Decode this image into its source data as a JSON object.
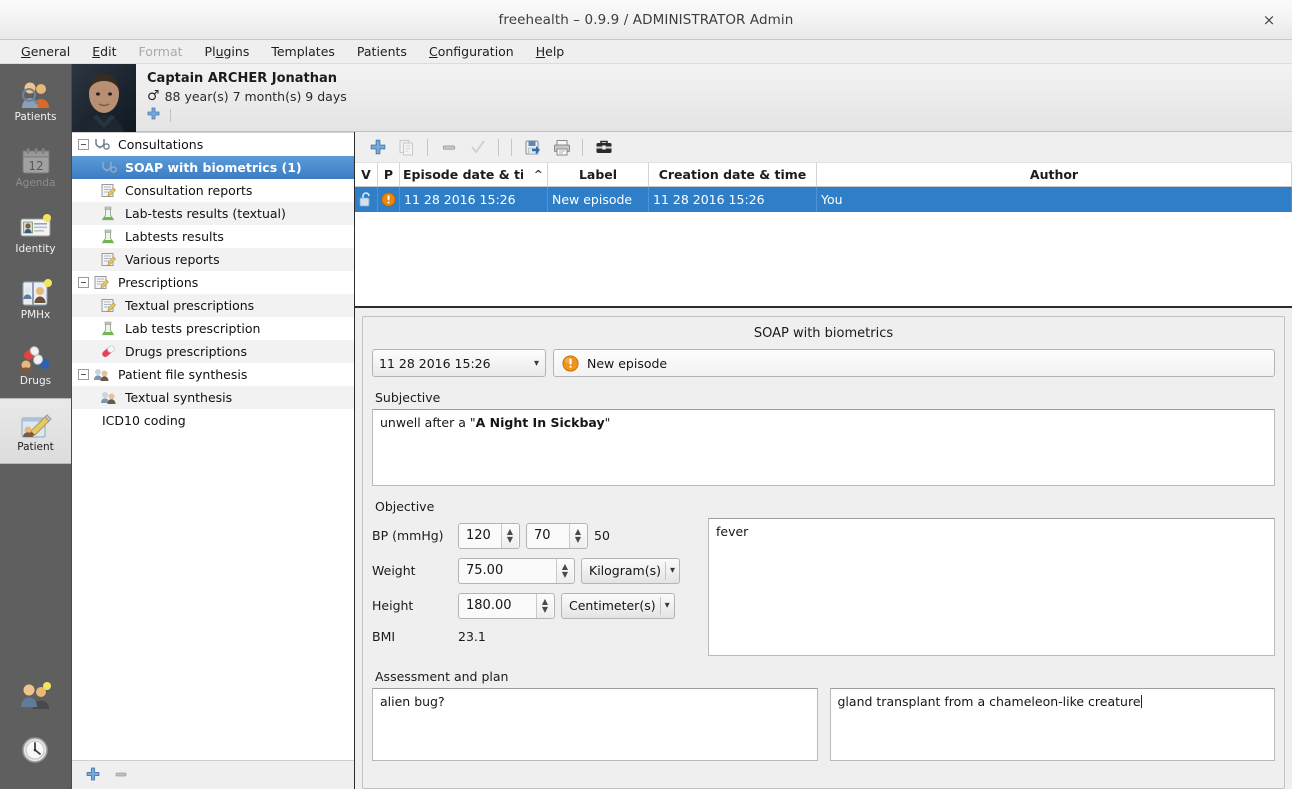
{
  "window": {
    "title": "freehealth – 0.9.9 / ADMINISTRATOR Admin",
    "close_label": "×"
  },
  "menubar": {
    "items": [
      {
        "label": "General",
        "mnemonic": "G",
        "disabled": false
      },
      {
        "label": "Edit",
        "mnemonic": "E",
        "disabled": false
      },
      {
        "label": "Format",
        "mnemonic": "",
        "disabled": true
      },
      {
        "label": "Plugins",
        "mnemonic": "u",
        "disabled": false
      },
      {
        "label": "Templates",
        "mnemonic": "",
        "disabled": false
      },
      {
        "label": "Patients",
        "mnemonic": "",
        "disabled": false
      },
      {
        "label": "Configuration",
        "mnemonic": "C",
        "disabled": false
      },
      {
        "label": "Help",
        "mnemonic": "H",
        "disabled": false
      }
    ]
  },
  "rail": {
    "items": [
      {
        "label": "Patients",
        "icon": "patients-icon",
        "selected": false,
        "disabled": false
      },
      {
        "label": "Agenda",
        "icon": "calendar-icon",
        "selected": false,
        "disabled": true
      },
      {
        "label": "Identity",
        "icon": "id-card-icon",
        "selected": false,
        "disabled": false
      },
      {
        "label": "PMHx",
        "icon": "medical-history-icon",
        "selected": false,
        "disabled": false
      },
      {
        "label": "Drugs",
        "icon": "pills-icon",
        "selected": false,
        "disabled": false
      },
      {
        "label": "Patient",
        "icon": "notepad-pencil-icon",
        "selected": true,
        "disabled": false
      }
    ],
    "bottom_items": [
      {
        "label": "",
        "icon": "user-group-icon"
      },
      {
        "label": "",
        "icon": "clock-icon"
      }
    ]
  },
  "patient_header": {
    "name": "Captain ARCHER Jonathan",
    "gender_symbol": "♂",
    "age": "88 year(s) 7 month(s) 9 days",
    "add_icon": "plus-icon",
    "avatar": "patient-photo"
  },
  "tree": {
    "nodes": [
      {
        "label": "Consultations",
        "icon": "stethoscope-icon",
        "level": 0,
        "expandable": true,
        "selected": false,
        "alt": false
      },
      {
        "label": "SOAP with biometrics (1)",
        "icon": "stethoscope-icon",
        "level": 1,
        "expandable": false,
        "selected": true,
        "alt": false
      },
      {
        "label": "Consultation reports",
        "icon": "report-icon",
        "level": 1,
        "expandable": false,
        "selected": false,
        "alt": false
      },
      {
        "label": "Lab-tests results (textual)",
        "icon": "flask-icon",
        "level": 1,
        "expandable": false,
        "selected": false,
        "alt": true
      },
      {
        "label": "Labtests results",
        "icon": "flask-icon",
        "level": 1,
        "expandable": false,
        "selected": false,
        "alt": false
      },
      {
        "label": "Various reports",
        "icon": "report-icon",
        "level": 1,
        "expandable": false,
        "selected": false,
        "alt": true
      },
      {
        "label": "Prescriptions",
        "icon": "report-icon",
        "level": 0,
        "expandable": true,
        "selected": false,
        "alt": false
      },
      {
        "label": "Textual prescriptions",
        "icon": "report-icon",
        "level": 1,
        "expandable": false,
        "selected": false,
        "alt": true
      },
      {
        "label": "Lab tests prescription",
        "icon": "flask-icon",
        "level": 1,
        "expandable": false,
        "selected": false,
        "alt": false
      },
      {
        "label": "Drugs prescriptions",
        "icon": "capsule-icon",
        "level": 1,
        "expandable": false,
        "selected": false,
        "alt": true
      },
      {
        "label": "Patient file synthesis",
        "icon": "synthesis-icon",
        "level": 0,
        "expandable": true,
        "selected": false,
        "alt": false
      },
      {
        "label": "Textual synthesis",
        "icon": "synthesis-icon",
        "level": 1,
        "expandable": false,
        "selected": false,
        "alt": true
      },
      {
        "label": "ICD10 coding",
        "icon": "none",
        "level": 0,
        "expandable": false,
        "selected": false,
        "alt": false
      }
    ],
    "footer": {
      "add_icon": "plus-icon",
      "remove_icon": "minus-icon"
    }
  },
  "episode_toolbar": {
    "buttons": [
      {
        "icon": "plus-icon",
        "disabled": false
      },
      {
        "icon": "duplicate-icon",
        "disabled": true
      },
      {
        "icon": "minus-icon",
        "disabled": false
      },
      {
        "icon": "validate-check-icon",
        "disabled": true
      },
      {
        "icon": "save-to-disk-icon",
        "disabled": false
      },
      {
        "icon": "print-icon",
        "disabled": false
      },
      {
        "icon": "toolbox-icon",
        "disabled": false
      }
    ]
  },
  "episode_table": {
    "columns": [
      "V",
      "P",
      "Episode date & time",
      "Label",
      "Creation date & time",
      "Author"
    ],
    "sort_column": "Episode date & time",
    "sort_direction": "ascending",
    "rows": [
      {
        "lock_icon": "unlocked-padlock-icon",
        "priority_icon": "warning-icon",
        "episode_datetime": "11 28 2016 15:26",
        "label": "New episode",
        "creation_datetime": "11 28 2016 15:26",
        "author": "You",
        "selected": true
      }
    ]
  },
  "form": {
    "title": "SOAP with biometrics",
    "episode_date": "11 28 2016 15:26",
    "episode_label": "New episode",
    "episode_label_icon": "warning-icon",
    "subjective": {
      "label": "Subjective",
      "text_plain": "unwell after a \"",
      "text_bold": "A Night In Sickbay",
      "text_tail": "\""
    },
    "objective": {
      "label": "Objective",
      "bp_label": "BP (mmHg)",
      "bp_systolic": "120",
      "bp_diastolic": "70",
      "bp_extra": "50",
      "weight_label": "Weight",
      "weight_value": "75.00",
      "weight_unit": "Kilogram(s)",
      "height_label": "Height",
      "height_value": "180.00",
      "height_unit": "Centimeter(s)",
      "bmi_label": "BMI",
      "bmi_value": "23.1",
      "notes": "fever"
    },
    "assessment": {
      "label": "Assessment and plan",
      "left_text": "alien bug?",
      "right_text": "gland transplant from a chameleon-like creature"
    }
  },
  "colors": {
    "selection_blue": "#2f7fc8",
    "tree_selection": "#3b7cc4",
    "rail_background": "#5f5f5f",
    "window_background": "#efefef",
    "warning_orange": "#e8880f",
    "accent_plus_blue": "#5a8fc8"
  }
}
